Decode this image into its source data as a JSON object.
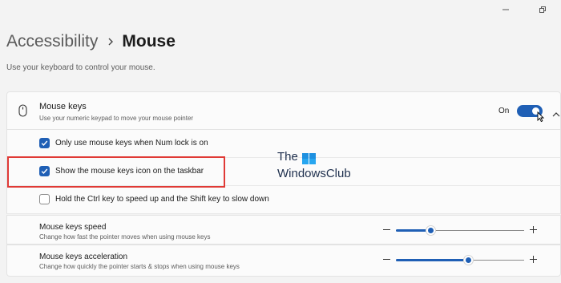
{
  "breadcrumb": {
    "parent": "Accessibility",
    "current": "Mouse"
  },
  "page_description": "Use your keyboard to control your mouse.",
  "mouse_keys": {
    "title": "Mouse keys",
    "subtitle": "Use your numeric keypad to move your mouse pointer",
    "state_label": "On",
    "toggle_on": true,
    "options": [
      {
        "label": "Only use mouse keys when Num lock is on",
        "checked": true
      },
      {
        "label": "Show the mouse keys icon on the taskbar",
        "checked": true
      },
      {
        "label": "Hold the Ctrl key to speed up and the Shift key to slow down",
        "checked": false
      }
    ]
  },
  "speed": {
    "title": "Mouse keys speed",
    "subtitle": "Change how fast the pointer moves when using mouse keys",
    "value_fraction": 0.27
  },
  "acceleration": {
    "title": "Mouse keys acceleration",
    "subtitle": "Change how quickly the pointer starts & stops when using mouse keys",
    "value_fraction": 0.56
  },
  "watermark": {
    "line1": "The",
    "line2": "WindowsClub"
  },
  "icons": {
    "window_controls": [
      "minimize-icon",
      "restore-icon"
    ],
    "mouse_keys": "mouse-icon",
    "expand": "chevron-up-icon",
    "check": "checkmark-icon",
    "breadcrumb_separator": "chevron-right-icon",
    "slider_decrease": "minus-icon",
    "slider_increase": "plus-icon"
  },
  "colors": {
    "accent": "#1f5fb5",
    "highlight_box": "#e03a36",
    "background": "#f3f3f3",
    "card": "#fbfbfb"
  }
}
